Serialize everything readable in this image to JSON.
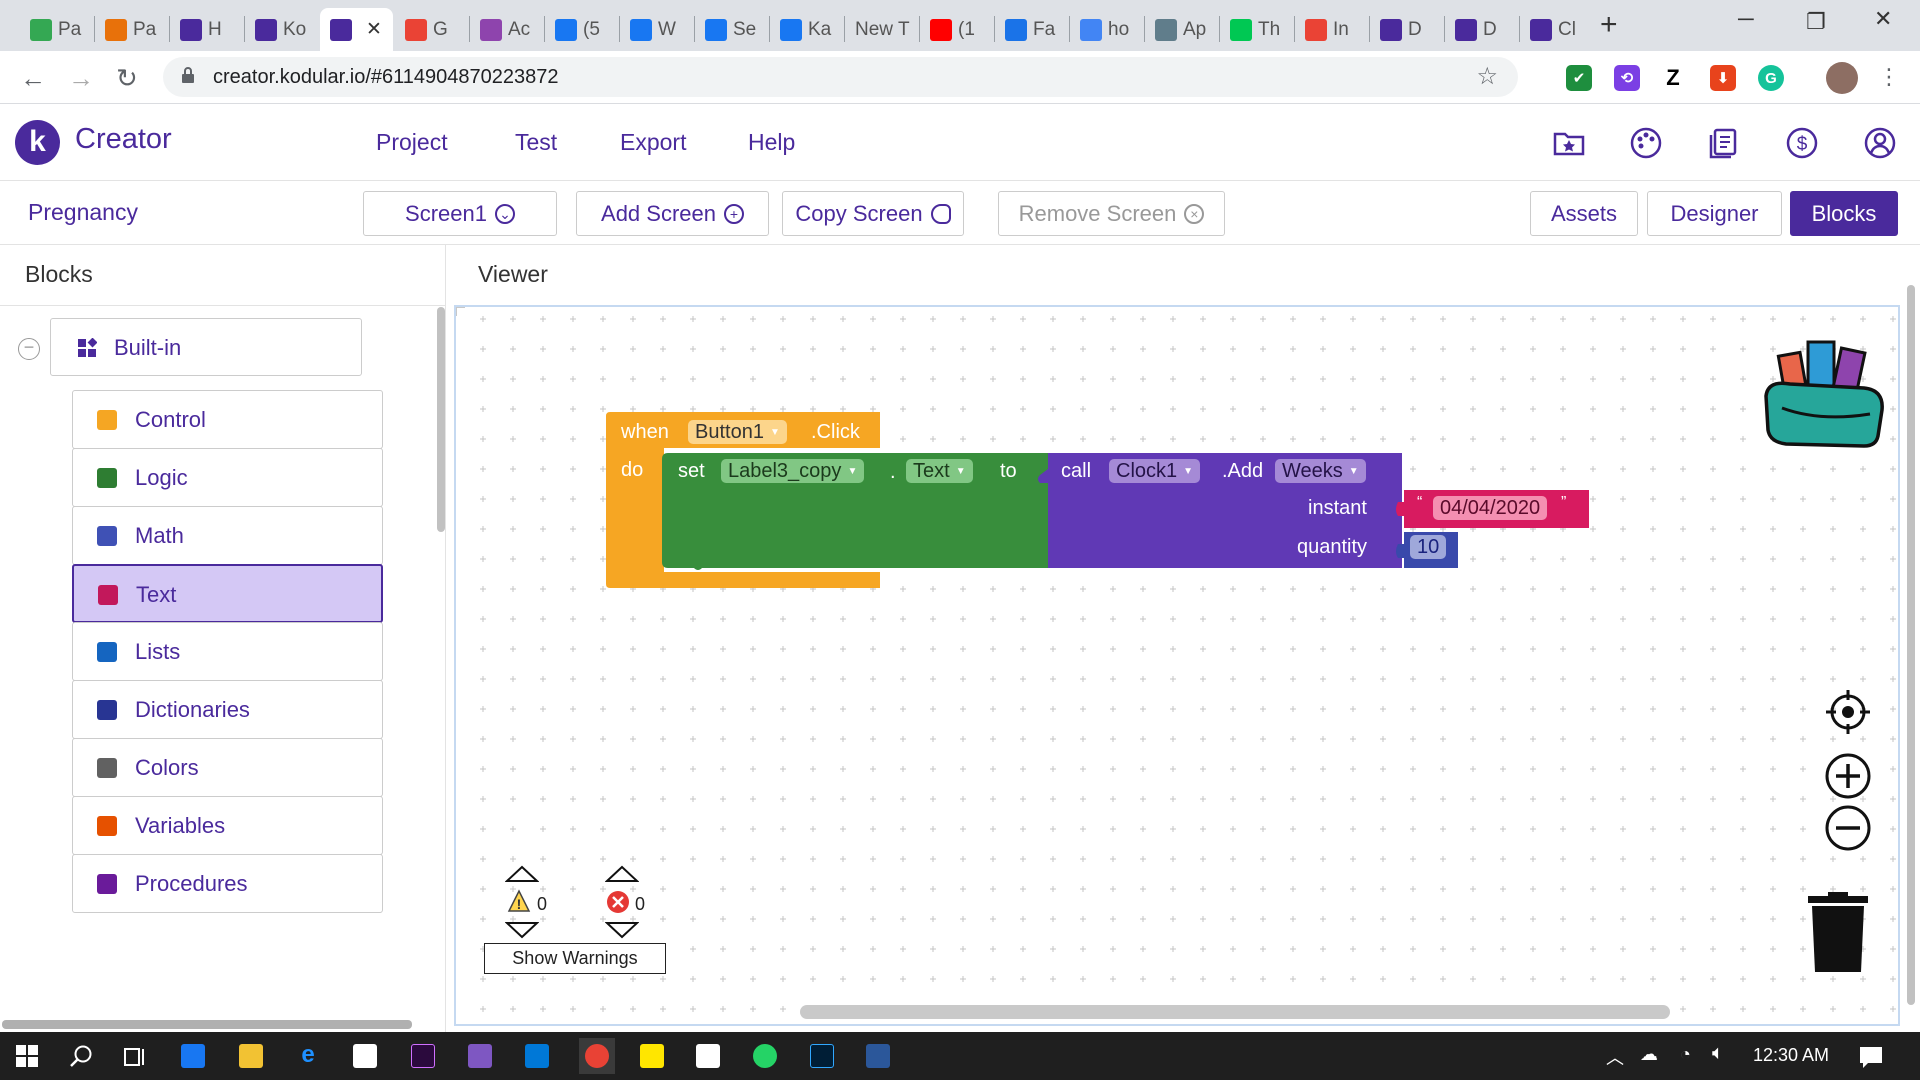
{
  "browser": {
    "tabs": [
      {
        "label": "Pa",
        "favicon": "code-icon",
        "color": "#34a853"
      },
      {
        "label": "Pa",
        "favicon": "m-icon",
        "color": "#e8710a"
      },
      {
        "label": "H",
        "favicon": "kodular-icon",
        "color": "#4a2a9c"
      },
      {
        "label": "Ko",
        "favicon": "kodular-icon",
        "color": "#4a2a9c"
      },
      {
        "label": "",
        "favicon": "kodular-icon",
        "color": "#4a2a9c",
        "active": true
      },
      {
        "label": "G",
        "favicon": "circle-icon",
        "color": "#ea4335"
      },
      {
        "label": "Ac",
        "favicon": "target-icon",
        "color": "#8e44ad"
      },
      {
        "label": "(5",
        "favicon": "facebook-icon",
        "color": "#1877f2"
      },
      {
        "label": "W",
        "favicon": "facebook-icon",
        "color": "#1877f2"
      },
      {
        "label": "Se",
        "favicon": "facebook-icon",
        "color": "#1877f2"
      },
      {
        "label": "Ka",
        "favicon": "facebook-icon",
        "color": "#1877f2"
      },
      {
        "label": "New T",
        "favicon": "",
        "color": ""
      },
      {
        "label": "(1",
        "favicon": "youtube-icon",
        "color": "#ff0000"
      },
      {
        "label": "Fa",
        "favicon": "k-icon",
        "color": "#1a73e8"
      },
      {
        "label": "ho",
        "favicon": "google-icon",
        "color": "#4285f4"
      },
      {
        "label": "Ap",
        "favicon": "appinventor-icon",
        "color": "#607d8b"
      },
      {
        "label": "Th",
        "favicon": "play-icon",
        "color": "#00c853"
      },
      {
        "label": "In",
        "favicon": "gmail-icon",
        "color": "#ea4335"
      },
      {
        "label": "D",
        "favicon": "kodular-icon",
        "color": "#4a2a9c"
      },
      {
        "label": "D",
        "favicon": "kodular-icon",
        "color": "#4a2a9c"
      },
      {
        "label": "Cl",
        "favicon": "kodular-icon",
        "color": "#4a2a9c"
      }
    ],
    "url": "creator.kodular.io/#6114904870223872"
  },
  "app": {
    "brand": "Creator",
    "menu": [
      "Project",
      "Test",
      "Export",
      "Help"
    ],
    "project_name": "Pregnancy",
    "screen_select": "Screen1",
    "add_screen": "Add Screen",
    "copy_screen": "Copy Screen",
    "remove_screen": "Remove Screen",
    "assets": "Assets",
    "designer": "Designer",
    "blocks": "Blocks"
  },
  "sidebar": {
    "title": "Blocks",
    "group": "Built-in",
    "items": [
      {
        "label": "Control",
        "icon": "control-icon",
        "color": "#f5a623"
      },
      {
        "label": "Logic",
        "icon": "logic-icon",
        "color": "#2e7d32"
      },
      {
        "label": "Math",
        "icon": "math-icon",
        "color": "#3f51b5"
      },
      {
        "label": "Text",
        "icon": "text-icon",
        "color": "#c2185b",
        "selected": true
      },
      {
        "label": "Lists",
        "icon": "lists-icon",
        "color": "#1565c0"
      },
      {
        "label": "Dictionaries",
        "icon": "dictionaries-icon",
        "color": "#283593"
      },
      {
        "label": "Colors",
        "icon": "colors-icon",
        "color": "#616161"
      },
      {
        "label": "Variables",
        "icon": "variables-icon",
        "color": "#e65100"
      },
      {
        "label": "Procedures",
        "icon": "procedures-icon",
        "color": "#6a1b9a"
      }
    ]
  },
  "viewer": {
    "title": "Viewer",
    "event": {
      "when": "when",
      "component": "Button1",
      "event_name": ".Click",
      "do": "do"
    },
    "setter": {
      "set": "set",
      "component": "Label3_copy",
      "dot": ".",
      "property": "Text",
      "to": "to"
    },
    "call": {
      "call": "call",
      "component": "Clock1",
      "method_prefix": ".Add",
      "method": "Weeks",
      "arg1": "instant",
      "arg2": "quantity"
    },
    "text_value": "04/04/2020",
    "number_value": "10",
    "warnings_count": "0",
    "errors_count": "0",
    "show_warnings": "Show Warnings"
  },
  "taskbar": {
    "time": "12:30 AM"
  }
}
